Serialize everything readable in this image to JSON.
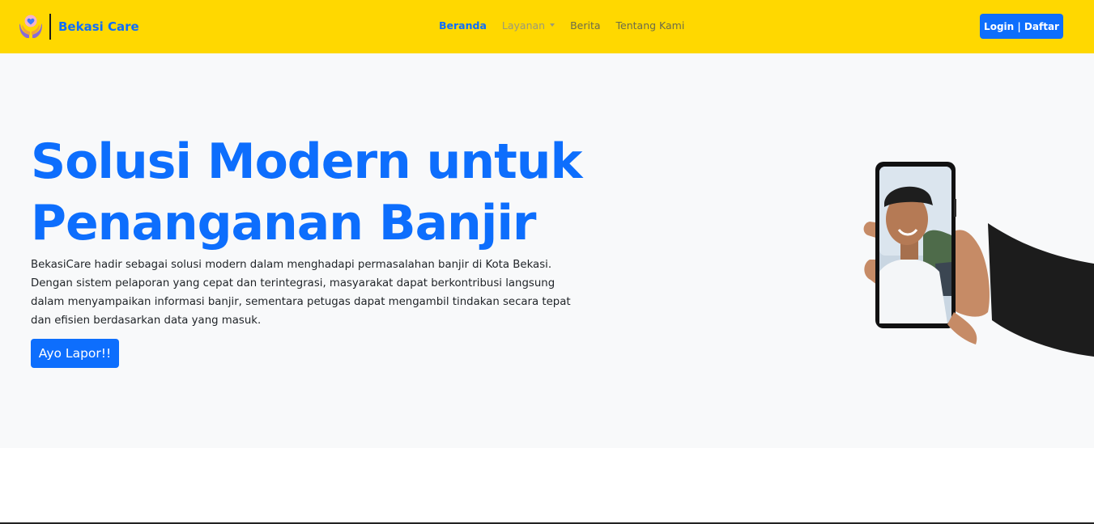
{
  "navbar": {
    "brand_name": "Bekasi Care",
    "logo_icon": "hands-heart-icon",
    "links": [
      {
        "label": "Beranda",
        "state": "active"
      },
      {
        "label": "Layanan",
        "state": "dropdown"
      },
      {
        "label": "Berita",
        "state": "normal"
      },
      {
        "label": "Tentang Kami",
        "state": "normal"
      }
    ],
    "login_label": "Login | Daftar"
  },
  "hero": {
    "title_line1": "Solusi Modern untuk",
    "title_line2": "Penanganan Banjir",
    "description": "BekasiCare hadir sebagai solusi modern dalam menghadapi permasalahan banjir di Kota Bekasi. Dengan sistem pelaporan yang cepat dan terintegrasi, masyarakat dapat berkontribusi langsung dalam menyampaikan informasi banjir, sementara petugas dapat mengambil tindakan secara tepat dan efisien berdasarkan data yang masuk.",
    "cta_label": "Ayo Lapor!!",
    "illustration": "hand-holding-phone-photo"
  },
  "colors": {
    "navbar_bg": "#ffd800",
    "accent": "#0d6efd",
    "hero_bg": "#f8f9fa"
  }
}
